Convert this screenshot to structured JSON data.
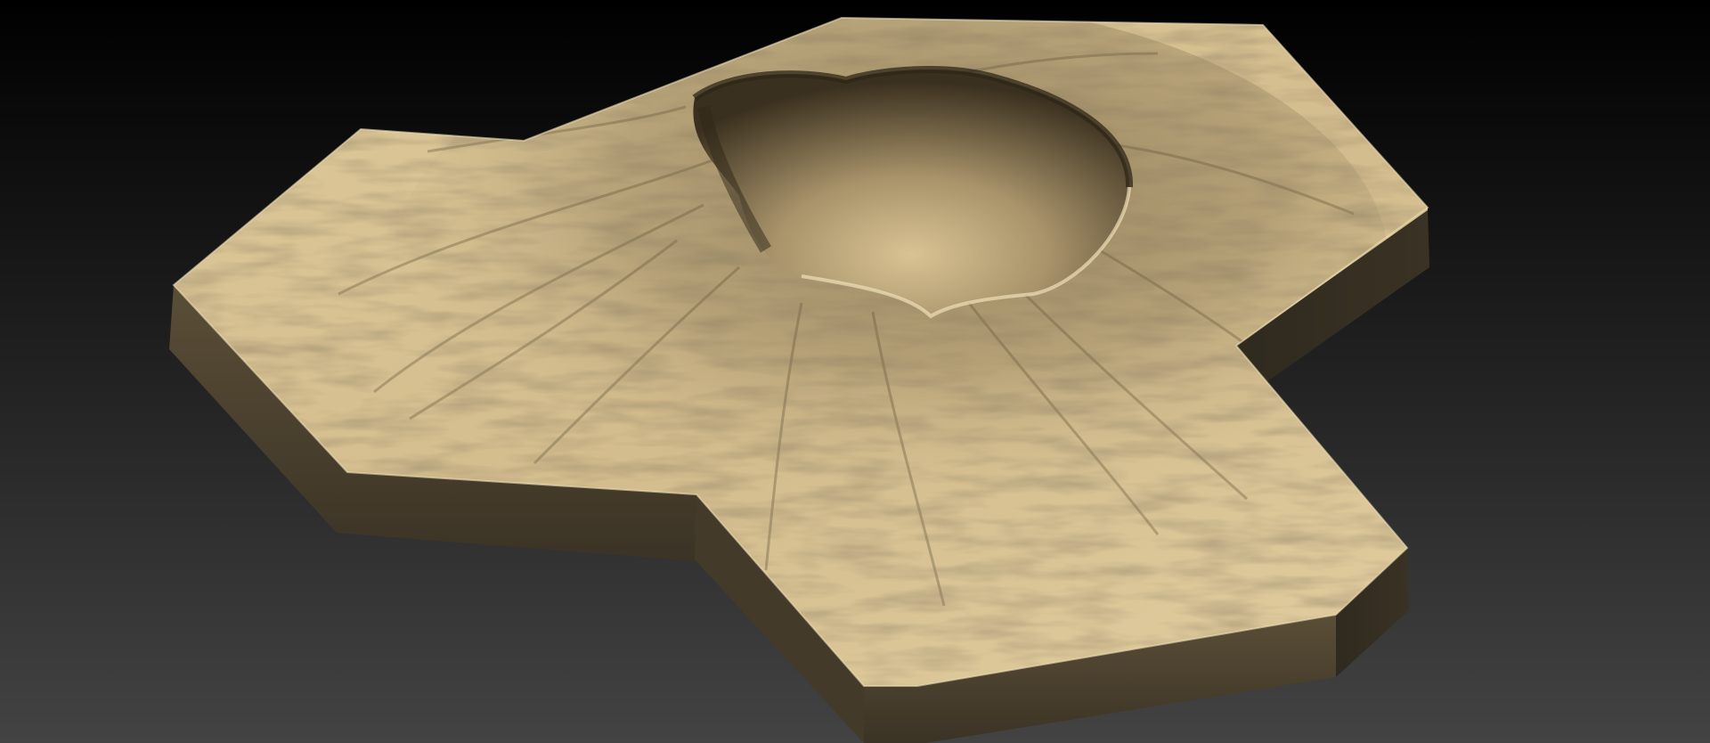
{
  "scene": {
    "subject": "volcano-crater-terrain",
    "colors": {
      "background_top": "#000000",
      "background_bottom": "#434343",
      "tile_top": "#d3bc8d",
      "tile_top_light": "#e6d3a6",
      "tile_shadow": "#6e5f40",
      "tile_side_front": "#4c4230",
      "tile_side_right": "#3a3224",
      "crater_dark": "#2e2617",
      "crater_wall": "#8f7d56"
    }
  }
}
